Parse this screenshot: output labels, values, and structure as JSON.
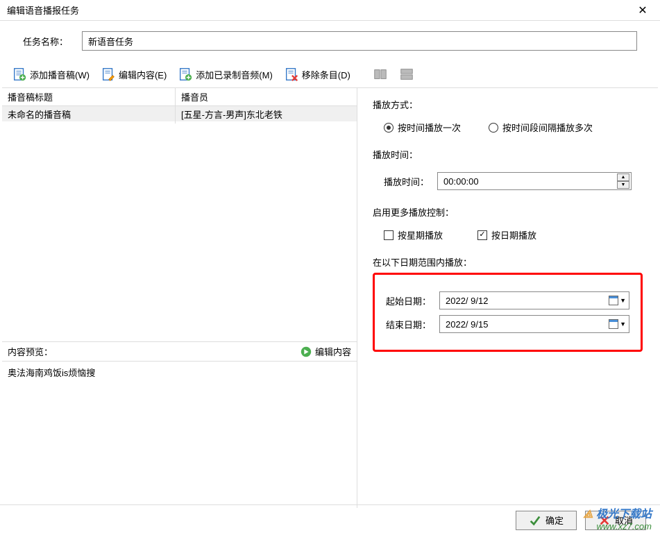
{
  "dialog": {
    "title": "编辑语音播报任务",
    "close_char": "✕"
  },
  "task_name": {
    "label": "任务名称：",
    "value": "新语音任务"
  },
  "toolbar": {
    "add_script": "添加播音稿(W)",
    "edit_content": "编辑内容(E)",
    "add_recorded": "添加已录制音频(M)",
    "remove_item": "移除条目(D)"
  },
  "list": {
    "header_title": "播音稿标题",
    "header_voice": "播音员",
    "rows": [
      {
        "title": "未命名的播音稿",
        "voice": "[五星-方言-男声]东北老铁"
      }
    ]
  },
  "preview": {
    "label": "内容预览：",
    "edit_link": "编辑内容",
    "text": "奥法海南鸡饭is烦恼搜"
  },
  "play_mode": {
    "label": "播放方式：",
    "option1": "按时间播放一次",
    "option2": "按时间段间隔播放多次",
    "selected": 1
  },
  "play_time": {
    "section_label": "播放时间：",
    "field_label": "播放时间：",
    "value": "00:00:00"
  },
  "more_control": {
    "label": "启用更多播放控制：",
    "chk_by_week": "按星期播放",
    "chk_by_week_checked": false,
    "chk_by_date": "按日期播放",
    "chk_by_date_checked": true
  },
  "date_range": {
    "label": "在以下日期范围内播放：",
    "start_label": "起始日期：",
    "start_value": "2022/ 9/12",
    "end_label": "结束日期：",
    "end_value": "2022/ 9/15"
  },
  "footer": {
    "ok": "确定",
    "cancel": "取消"
  },
  "watermark": {
    "line1": "极光下载站",
    "line2": "www.xz7.com"
  }
}
